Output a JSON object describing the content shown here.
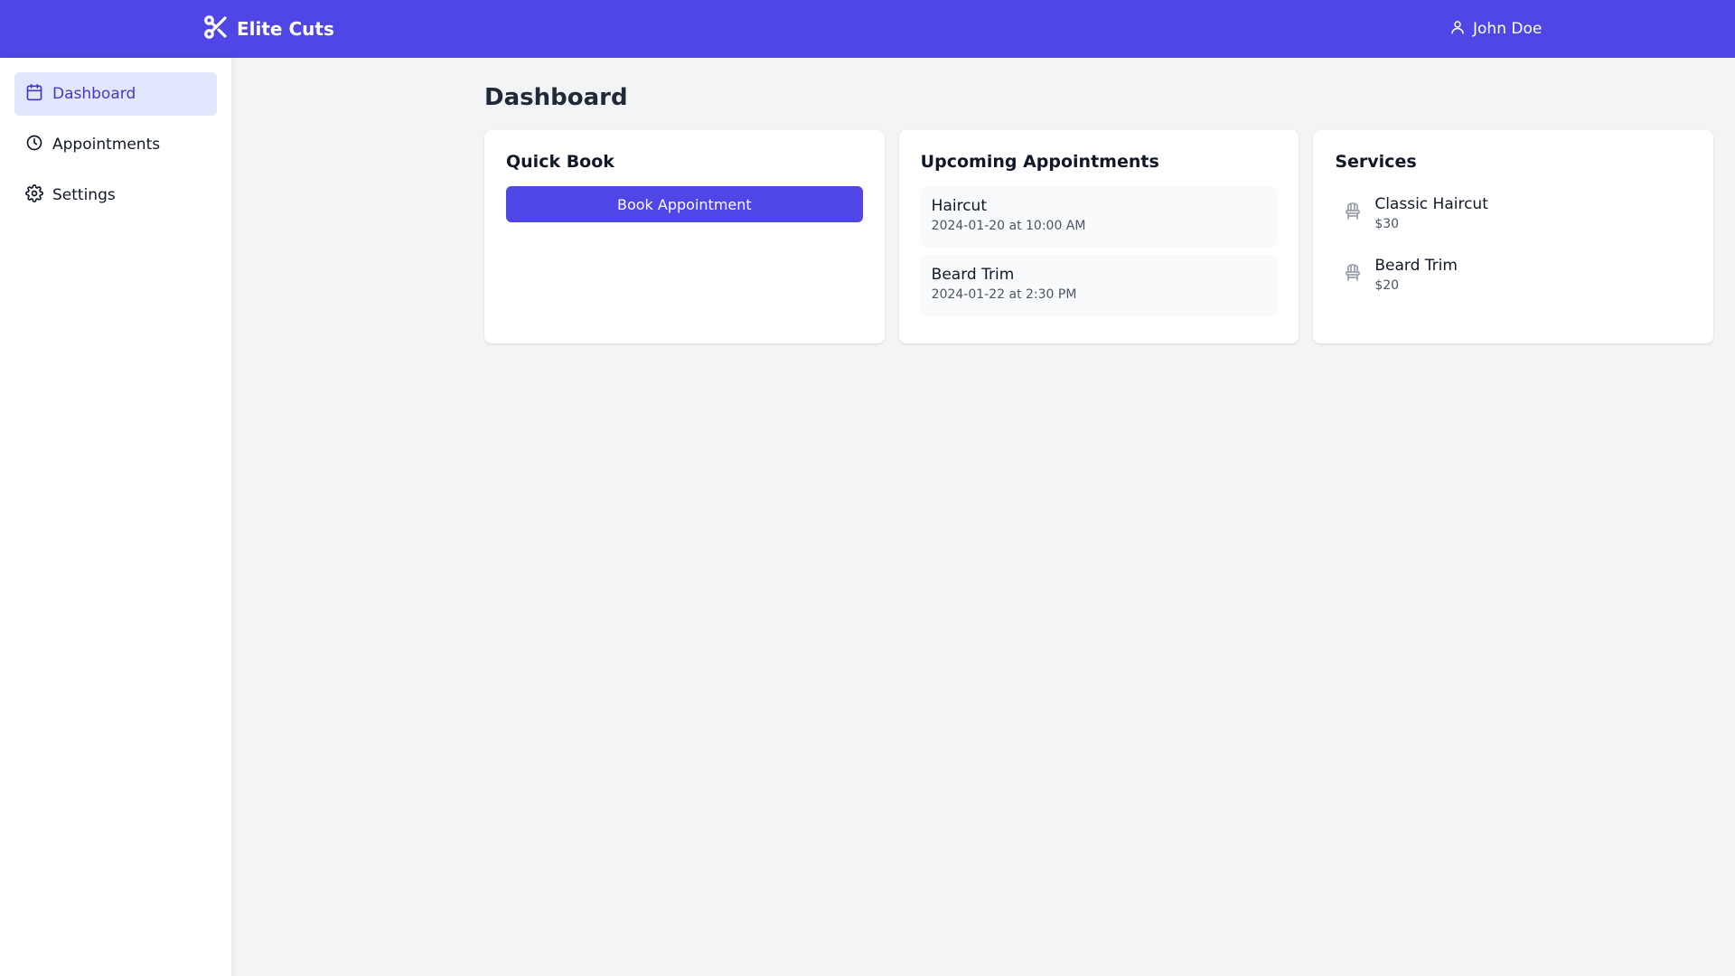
{
  "header": {
    "brand_name": "Elite Cuts",
    "user_name": "John Doe",
    "brand_color": "#4f46e5"
  },
  "sidebar": {
    "items": [
      {
        "label": "Dashboard",
        "icon": "calendar-icon",
        "active": true
      },
      {
        "label": "Appointments",
        "icon": "clock-icon",
        "active": false
      },
      {
        "label": "Settings",
        "icon": "gear-icon",
        "active": false
      }
    ]
  },
  "main": {
    "title": "Dashboard",
    "quick_book": {
      "title": "Quick Book",
      "button_label": "Book Appointment"
    },
    "upcoming": {
      "title": "Upcoming Appointments",
      "items": [
        {
          "service": "Haircut",
          "time": "2024-01-20 at 10:00 AM"
        },
        {
          "service": "Beard Trim",
          "time": "2024-01-22 at 2:30 PM"
        }
      ]
    },
    "services": {
      "title": "Services",
      "items": [
        {
          "name": "Classic Haircut",
          "price": "$30",
          "icon": "barber-chair-icon"
        },
        {
          "name": "Beard Trim",
          "price": "$20",
          "icon": "barber-chair-icon"
        }
      ]
    }
  }
}
